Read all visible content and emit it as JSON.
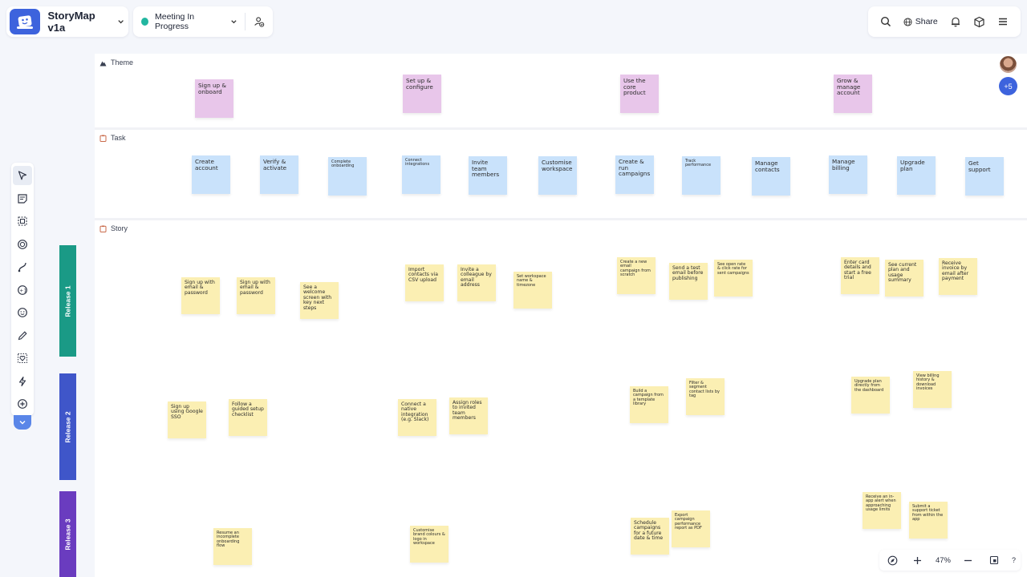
{
  "header": {
    "board_title": "StoryMap v1a",
    "status_label": "Meeting In Progress",
    "status_color": "#22b6a0",
    "share_label": "Share",
    "icons": [
      "search-icon",
      "globe-icon",
      "bell-icon",
      "cube-icon",
      "menu-icon"
    ]
  },
  "lanes": {
    "theme": "Theme",
    "task": "Task",
    "story": "Story"
  },
  "themes": [
    "Sign up & onboard",
    "Set up & configure",
    "Use the core product",
    "Grow & manage account"
  ],
  "tasks": [
    "Create account",
    "Verify & activate",
    "Complete onboarding",
    "Connect integrations",
    "Invite team members",
    "Customise workspace",
    "Create & run campaigns",
    "Track performance",
    "Manage contacts",
    "Manage billing",
    "Upgrade plan",
    "Get support"
  ],
  "releases": [
    {
      "label": "Release 1",
      "color": "#1a9a86"
    },
    {
      "label": "Release 2",
      "color": "#3f56c9"
    },
    {
      "label": "Release 3",
      "color": "#6a3cbf"
    }
  ],
  "stories": {
    "r1": [
      "Sign up with email & password",
      "Sign up with email & password",
      "See a welcome screen with key next steps",
      "Import contacts via CSV upload",
      "Invite a colleague by email address",
      "Set workspace name & timezone",
      "Create a new email campaign from scratch",
      "Send a test email before publishing",
      "See open rate & click rate for sent campaigns",
      "Enter card details and start a free trial",
      "See current plan and usage summary",
      "Receive invoice by email after payment"
    ],
    "r2": [
      "Sign up using Google SSO",
      "Follow a guided setup checklist",
      "Connect a native integration (e.g. Slack)",
      "Assign roles to invited team members",
      "Build a campaign from a template library",
      "Filter & segment contact lists by tag",
      "Upgrade plan directly from the dashboard",
      "View billing history & download invoices"
    ],
    "r3": [
      "Resume an incomplete onboarding flow",
      "Customise brand colours & logo in workspace",
      "Schedule campaigns for a future date & time",
      "Export campaign performance report as PDF",
      "Receive an in-app alert when approaching usage limits",
      "Submit a support ticket from within the app"
    ]
  },
  "collaborators": {
    "more_label": "+5"
  },
  "zoom": {
    "level": "47%",
    "help_label": "?"
  }
}
